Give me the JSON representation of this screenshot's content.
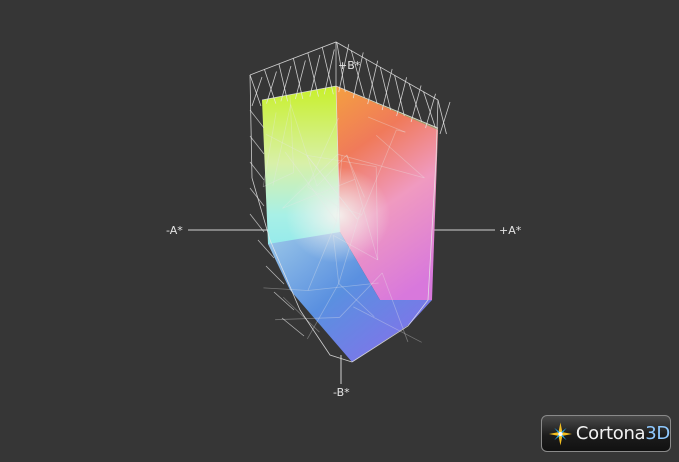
{
  "viewer": {
    "axis_labels": {
      "minus_a": "-A*",
      "plus_a": "+A*",
      "plus_b": "+B*",
      "minus_b": "-B*"
    },
    "brand": {
      "name": "Cortona",
      "suffix": "3D",
      "suffix_color": "#8fc9ff"
    },
    "colors": {
      "background": "#363636",
      "wireframe": "#e8e8e8",
      "axis": "#d0d0d0"
    }
  }
}
